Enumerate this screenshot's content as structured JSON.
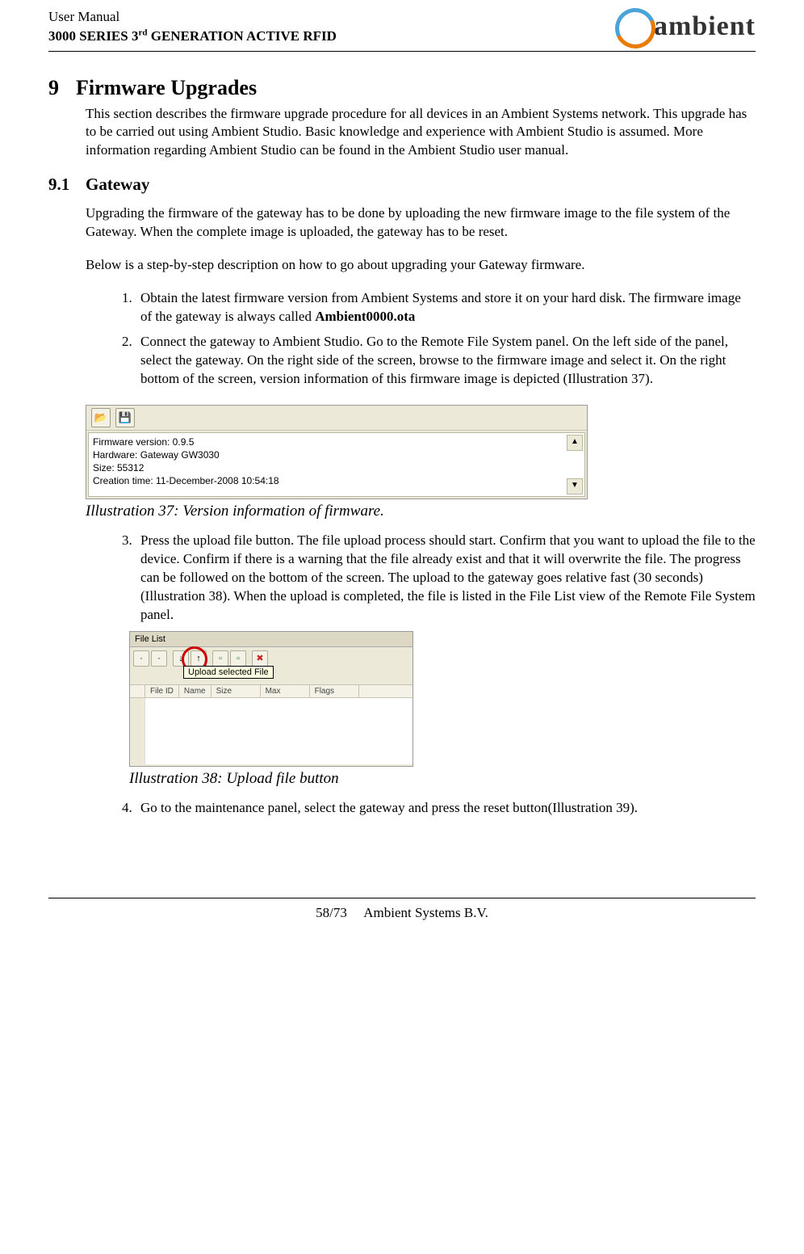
{
  "header": {
    "line1": "User Manual",
    "line2_pre": "3000 SERIES 3",
    "line2_sup": "rd",
    "line2_post": " GENERATION ACTIVE RFID",
    "logo_text": "ambient"
  },
  "section": {
    "num": "9",
    "title": "Firmware Upgrades",
    "intro": "This section describes the firmware upgrade procedure for all devices in an Ambient Systems network. This upgrade has to be carried out using Ambient Studio. Basic knowledge and experience with Ambient Studio is assumed. More information regarding Ambient Studio can be found in the Ambient Studio user manual."
  },
  "subsection": {
    "num": "9.1",
    "title": "Gateway",
    "p1": "Upgrading the firmware of the gateway has to be done by uploading the new firmware image to the file system of the Gateway. When the complete image is uploaded, the gateway has to be reset.",
    "p2": "Below is a step-by-step description on how to go about upgrading your Gateway firmware."
  },
  "steps": {
    "s1_pre": "Obtain the latest firmware version from Ambient Systems and store it on your hard disk. The firmware image of the gateway is always called ",
    "s1_bold": "Ambient0000.ota",
    "s2": "Connect the gateway to Ambient Studio. Go to the Remote File System panel. On the left side of the panel, select the gateway.  On the right side of the screen, browse to the firmware image and select it. On the right bottom of the screen, version information of this firmware image is depicted (Illustration 37).",
    "s3": "Press the upload file button. The file upload process should start. Confirm that you want to upload the file to the device. Confirm if there is a warning that the file already exist and that it will overwrite the file. The progress can be followed on the bottom of the screen. The upload to the gateway goes relative fast (30 seconds) (Illustration 38). When the upload is completed, the file is listed in the File  List view of the Remote File System panel.",
    "s4": "Go to the maintenance panel, select the gateway and press the reset button(Illustration 39)."
  },
  "fig37": {
    "caption": "Illustration 37: Version information of firmware.",
    "lines": {
      "l1": "Firmware version: 0.9.5",
      "l2": "Hardware: Gateway GW3030",
      "l3": "Size: 55312",
      "l4": "Creation time: 11-December-2008 10:54:18"
    }
  },
  "fig38": {
    "caption": "Illustration 38: Upload file button",
    "title": "File List",
    "tooltip": "Upload selected File",
    "cols": {
      "c1": "File ID",
      "c2": "Name",
      "c3": "Size",
      "c4": "Max",
      "c5": "Flags"
    }
  },
  "footer": {
    "page": "58/73",
    "org": "Ambient Systems B.V."
  }
}
